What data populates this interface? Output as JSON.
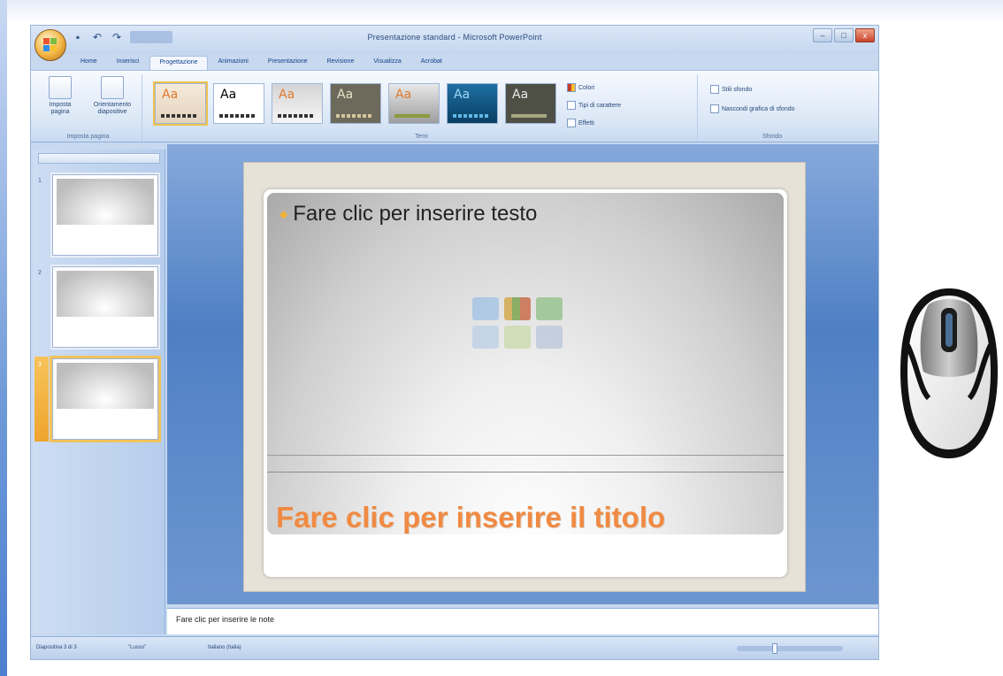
{
  "window": {
    "title": "Presentazione standard - Microsoft PowerPoint",
    "controls": {
      "minimize": "–",
      "maximize": "□",
      "close": "x"
    }
  },
  "quick_access": [
    "save-icon",
    "undo-icon",
    "redo-icon"
  ],
  "tabs": [
    "Home",
    "Inserisci",
    "Progettazione",
    "Animazioni",
    "Presentazione",
    "Revisione",
    "Visualizza",
    "Acrobat"
  ],
  "active_tab": "Progettazione",
  "ribbon": {
    "page_setup": {
      "label": "Imposta pagina",
      "buttons": [
        "Imposta pagina",
        "Orientamento diapositive"
      ]
    },
    "themes": {
      "label": "Temi",
      "thumb_text": "Aa",
      "options": [
        "Colori",
        "Tipi di carattere",
        "Effetti"
      ]
    },
    "background": {
      "label": "Sfondo",
      "options": [
        "Stili sfondo",
        "Nascondi grafica di sfondo"
      ]
    }
  },
  "slides_pane": {
    "thumbnails": [
      "1",
      "2",
      "3"
    ],
    "selected": "3"
  },
  "slide": {
    "bullet_text": "Fare clic per inserire testo",
    "title_text": "Fare clic per inserire il titolo"
  },
  "notes": {
    "text": "Fare clic per inserire le note"
  },
  "statusbar": {
    "slide_info": "Diapositiva 3 di 3",
    "theme": "\"Lusso\"",
    "language": "Italiano (Italia)"
  },
  "colors": {
    "title_orange": "#f08a43",
    "bullet_gold": "#f1b23a",
    "ribbon_blue": "#dbe7f6",
    "selection_gold": "#f2c35a"
  }
}
